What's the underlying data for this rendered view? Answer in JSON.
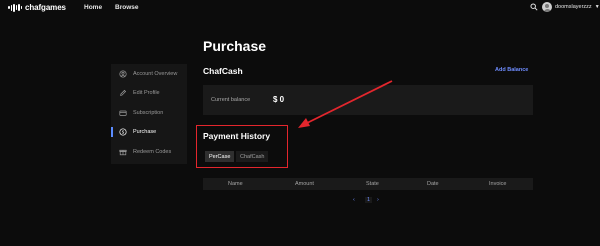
{
  "nav": {
    "logo_text": "chafgames",
    "links": [
      {
        "label": "Home"
      },
      {
        "label": "Browse"
      }
    ],
    "username": "doomslayerzzz"
  },
  "page": {
    "title": "Purchase"
  },
  "sidebar": {
    "items": [
      {
        "label": "Account Overview",
        "icon": "user-circle-icon"
      },
      {
        "label": "Edit Profile",
        "icon": "pencil-icon"
      },
      {
        "label": "Subscription",
        "icon": "card-icon"
      },
      {
        "label": "Purchase",
        "icon": "dollar-circle-icon",
        "active": true
      },
      {
        "label": "Redeem Codes",
        "icon": "gift-icon"
      }
    ]
  },
  "chafcash": {
    "title": "ChafCash",
    "add_balance": "Add Balance",
    "current_balance_label": "Current balance",
    "current_balance_value": "$ 0"
  },
  "payment_history": {
    "title": "Payment History",
    "tabs": [
      {
        "label": "PerCase",
        "active": true
      },
      {
        "label": "ChafCash",
        "active": false
      }
    ],
    "columns": [
      "Name",
      "Amount",
      "State",
      "Date",
      "Invoice"
    ],
    "rows": []
  },
  "pagination": {
    "prev": "‹",
    "current": "1",
    "next": "›"
  },
  "colors": {
    "background": "#0c0c0c",
    "panel": "#1a1a1a",
    "accent": "#6f8dff",
    "annotation": "#e3262d"
  }
}
